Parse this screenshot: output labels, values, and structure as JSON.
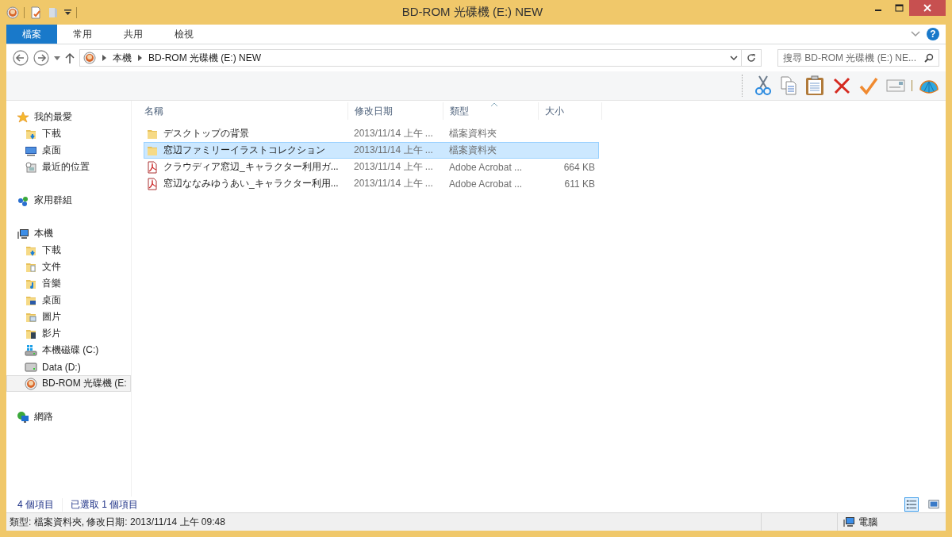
{
  "window": {
    "title": "BD-ROM 光碟機 (E:) NEW"
  },
  "ribbon": {
    "tabs": [
      {
        "label": "檔案",
        "selected": true
      },
      {
        "label": "常用",
        "selected": false
      },
      {
        "label": "共用",
        "selected": false
      },
      {
        "label": "檢視",
        "selected": false
      }
    ],
    "help": "?"
  },
  "address": {
    "crumbs": [
      "本機",
      "BD-ROM 光碟機 (E:) NEW"
    ],
    "search_placeholder": "搜尋 BD-ROM 光碟機 (E:) NE..."
  },
  "sidebar": {
    "groups": [
      {
        "label": "我的最愛",
        "kind": "star",
        "selected": false,
        "children": [
          {
            "label": "下載",
            "kind": "download",
            "selected": false
          },
          {
            "label": "桌面",
            "kind": "desktop",
            "selected": false
          },
          {
            "label": "最近的位置",
            "kind": "recent",
            "selected": false
          }
        ]
      },
      {
        "label": "家用群組",
        "kind": "homegroup",
        "selected": false
      },
      {
        "label": "本機",
        "kind": "computer",
        "selected": false,
        "children": [
          {
            "label": "下載",
            "kind": "download",
            "selected": false
          },
          {
            "label": "文件",
            "kind": "docs",
            "selected": false
          },
          {
            "label": "音樂",
            "kind": "music",
            "selected": false
          },
          {
            "label": "桌面",
            "kind": "desktop-folder",
            "selected": false
          },
          {
            "label": "圖片",
            "kind": "pictures",
            "selected": false
          },
          {
            "label": "影片",
            "kind": "videos",
            "selected": false
          },
          {
            "label": "本機磁碟 (C:)",
            "kind": "windrive",
            "selected": false
          },
          {
            "label": "Data (D:)",
            "kind": "drive",
            "selected": false
          },
          {
            "label": "BD-ROM 光碟機 (E:",
            "kind": "disc",
            "selected": true
          }
        ]
      },
      {
        "label": "網路",
        "kind": "network",
        "selected": false
      }
    ]
  },
  "table": {
    "columns": [
      {
        "label": "名稱",
        "sorted": false
      },
      {
        "label": "修改日期",
        "sorted": false
      },
      {
        "label": "類型",
        "sorted": true
      },
      {
        "label": "大小",
        "sorted": false
      }
    ],
    "rows": [
      {
        "kind": "folder",
        "name": "デスクトップの背景",
        "date": "2013/11/14 上午 ...",
        "type": "檔案資料夾",
        "selected": false
      },
      {
        "kind": "folder",
        "name": "窓辺ファミリーイラストコレクション",
        "date": "2013/11/14 上午 ...",
        "type": "檔案資料夾",
        "selected": true
      },
      {
        "kind": "pdf",
        "name": "クラウディア窓辺_キャラクター利用ガ...",
        "date": "2013/11/14 上午 ...",
        "type": "Adobe Acrobat ...",
        "size": "664 KB",
        "selected": false
      },
      {
        "kind": "pdf",
        "name": "窓辺ななみゆうあい_キャラクター利用...",
        "date": "2013/11/14 上午 ...",
        "type": "Adobe Acrobat ...",
        "size": "611 KB",
        "selected": false
      }
    ]
  },
  "counts": [
    "4 個項目",
    "已選取 1 個項目"
  ],
  "views": [
    {
      "kind": "details",
      "selected": true
    },
    {
      "kind": "large",
      "selected": false
    }
  ],
  "status_bar": {
    "text": "類型: 檔案資料夾, 修改日期: 2013/11/14 上午 09:48",
    "zone": "電腦"
  }
}
